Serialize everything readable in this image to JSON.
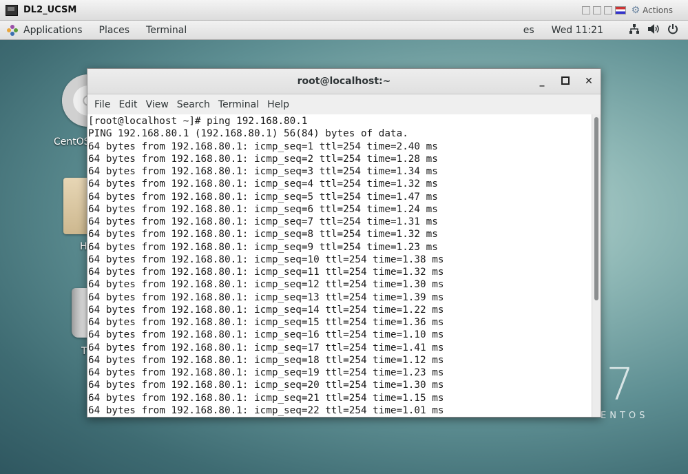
{
  "vm_bar": {
    "title": "DL2_UCSM",
    "actions_label": "Actions"
  },
  "panel": {
    "applications": "Applications",
    "places": "Places",
    "terminal": "Terminal",
    "language": "es",
    "clock": "Wed 11:21",
    "icons": [
      "network-icon",
      "volume-icon",
      "power-icon"
    ]
  },
  "desktop": {
    "disc_label": "CentOS",
    "folder_label": "H",
    "trash_label": "T",
    "brand_number": "7",
    "brand_word": "ENTOS"
  },
  "terminal_window": {
    "title": "root@localhost:~",
    "menu": [
      "File",
      "Edit",
      "View",
      "Search",
      "Terminal",
      "Help"
    ],
    "lines": [
      "[root@localhost ~]# ping 192.168.80.1",
      "PING 192.168.80.1 (192.168.80.1) 56(84) bytes of data.",
      "64 bytes from 192.168.80.1: icmp_seq=1 ttl=254 time=2.40 ms",
      "64 bytes from 192.168.80.1: icmp_seq=2 ttl=254 time=1.28 ms",
      "64 bytes from 192.168.80.1: icmp_seq=3 ttl=254 time=1.34 ms",
      "64 bytes from 192.168.80.1: icmp_seq=4 ttl=254 time=1.32 ms",
      "64 bytes from 192.168.80.1: icmp_seq=5 ttl=254 time=1.47 ms",
      "64 bytes from 192.168.80.1: icmp_seq=6 ttl=254 time=1.24 ms",
      "64 bytes from 192.168.80.1: icmp_seq=7 ttl=254 time=1.31 ms",
      "64 bytes from 192.168.80.1: icmp_seq=8 ttl=254 time=1.32 ms",
      "64 bytes from 192.168.80.1: icmp_seq=9 ttl=254 time=1.23 ms",
      "64 bytes from 192.168.80.1: icmp_seq=10 ttl=254 time=1.38 ms",
      "64 bytes from 192.168.80.1: icmp_seq=11 ttl=254 time=1.32 ms",
      "64 bytes from 192.168.80.1: icmp_seq=12 ttl=254 time=1.30 ms",
      "64 bytes from 192.168.80.1: icmp_seq=13 ttl=254 time=1.39 ms",
      "64 bytes from 192.168.80.1: icmp_seq=14 ttl=254 time=1.22 ms",
      "64 bytes from 192.168.80.1: icmp_seq=15 ttl=254 time=1.36 ms",
      "64 bytes from 192.168.80.1: icmp_seq=16 ttl=254 time=1.10 ms",
      "64 bytes from 192.168.80.1: icmp_seq=17 ttl=254 time=1.41 ms",
      "64 bytes from 192.168.80.1: icmp_seq=18 ttl=254 time=1.12 ms",
      "64 bytes from 192.168.80.1: icmp_seq=19 ttl=254 time=1.23 ms",
      "64 bytes from 192.168.80.1: icmp_seq=20 ttl=254 time=1.30 ms",
      "64 bytes from 192.168.80.1: icmp_seq=21 ttl=254 time=1.15 ms",
      "64 bytes from 192.168.80.1: icmp_seq=22 ttl=254 time=1.01 ms"
    ]
  }
}
